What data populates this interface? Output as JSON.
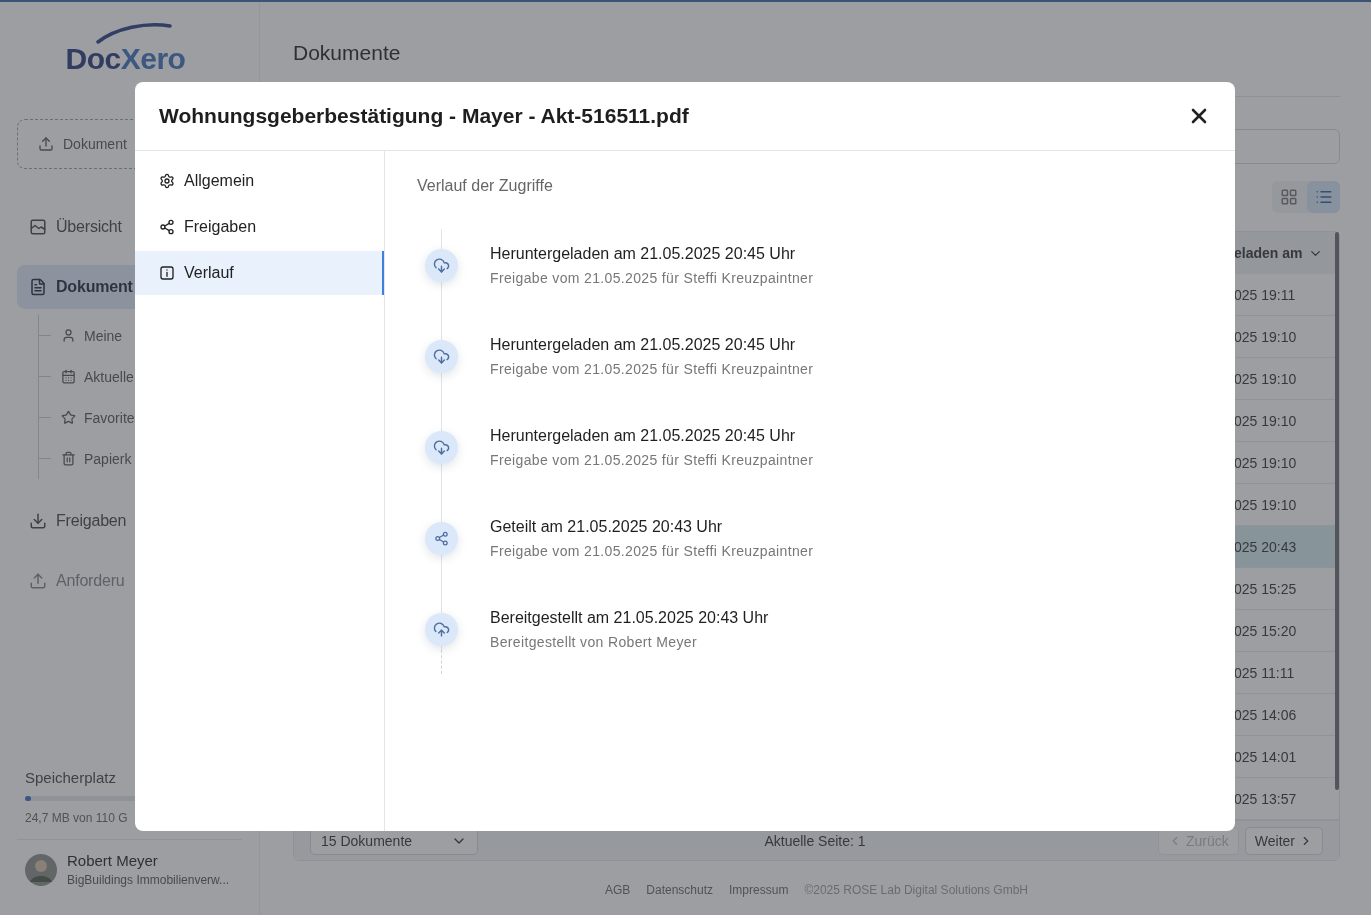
{
  "app": {
    "logo": [
      "Doc",
      "Xero"
    ],
    "upload_button": "Dokument",
    "nav": [
      {
        "label": "Übersicht",
        "selected": false,
        "disabled": false
      },
      {
        "label": "Dokument",
        "selected": true,
        "disabled": false,
        "children": [
          {
            "label": "Meine",
            "selected": false
          },
          {
            "label": "Aktuelle",
            "selected": false
          },
          {
            "label": "Favorite",
            "selected": false
          },
          {
            "label": "Papierk",
            "selected": false
          }
        ]
      },
      {
        "label": "Freigaben",
        "selected": false,
        "disabled": false
      },
      {
        "label": "Anforderu",
        "selected": false,
        "disabled": true
      }
    ],
    "storage": {
      "label": "Speicherplatz",
      "level": 0.03,
      "reading": "24,7 MB von 110 G"
    },
    "user": {
      "name": "Robert Meyer",
      "organization": "BigBuildings Immobilienverw..."
    }
  },
  "page": {
    "title": "Dokumente",
    "view_toggle": [
      {
        "kind": "grid",
        "selected": false
      },
      {
        "kind": "list",
        "selected": true
      }
    ],
    "table": {
      "columns": [
        "eladen am"
      ],
      "rows": [
        {
          "cell": "025 19:11",
          "selected": false
        },
        {
          "cell": "025 19:10",
          "selected": false
        },
        {
          "cell": "025 19:10",
          "selected": false
        },
        {
          "cell": "025 19:10",
          "selected": false
        },
        {
          "cell": "025 19:10",
          "selected": false
        },
        {
          "cell": "025 19:10",
          "selected": false
        },
        {
          "cell": "025 20:43",
          "selected": true
        },
        {
          "cell": "025 15:25",
          "selected": false
        },
        {
          "cell": "025 15:20",
          "selected": false
        },
        {
          "cell": "025 11:11",
          "selected": false
        },
        {
          "cell": "025 14:06",
          "selected": false
        },
        {
          "cell": "025 14:01",
          "selected": false
        },
        {
          "cell": "025 13:57",
          "selected": false
        }
      ]
    },
    "pagination": {
      "page_size": "15 Dokumente",
      "current": "Aktuelle Seite: 1",
      "prev": {
        "label": "Zurück",
        "disabled": true
      },
      "next": {
        "label": "Weiter",
        "disabled": false
      }
    },
    "footer": [
      "AGB",
      "Datenschutz",
      "Impressum",
      "©2025 ROSE Lab Digital Solutions GmbH"
    ]
  },
  "dialog": {
    "title": "Wohnungsgeberbestätigung - Mayer - Akt-516511.pdf",
    "tabs": [
      {
        "label": "Allgemein",
        "selected": false
      },
      {
        "label": "Freigaben",
        "selected": false
      },
      {
        "label": "Verlauf",
        "selected": true
      }
    ],
    "heading": "Verlauf der Zugriffe",
    "events": [
      {
        "kind": "download",
        "title": "Heruntergeladen am 21.05.2025 20:45 Uhr",
        "detail": "Freigabe vom 21.05.2025 für Steffi Kreuzpaintner"
      },
      {
        "kind": "download",
        "title": "Heruntergeladen am 21.05.2025 20:45 Uhr",
        "detail": "Freigabe vom 21.05.2025 für Steffi Kreuzpaintner"
      },
      {
        "kind": "download",
        "title": "Heruntergeladen am 21.05.2025 20:45 Uhr",
        "detail": "Freigabe vom 21.05.2025 für Steffi Kreuzpaintner"
      },
      {
        "kind": "share",
        "title": "Geteilt am 21.05.2025 20:43 Uhr",
        "detail": "Freigabe vom 21.05.2025 für Steffi Kreuzpaintner"
      },
      {
        "kind": "upload",
        "title": "Bereitgestellt am 21.05.2025 20:43 Uhr",
        "detail": "Bereitgestellt von Robert Meyer"
      }
    ]
  }
}
